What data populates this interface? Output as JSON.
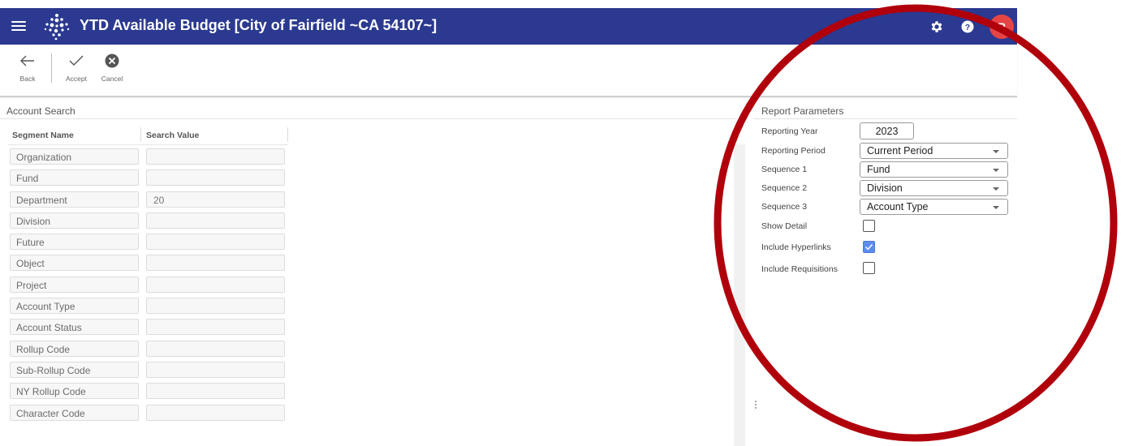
{
  "header": {
    "title": "YTD Available Budget [City of Fairfield ~CA 54107~]",
    "menu_icon": "hamburger-icon",
    "logo_icon": "dotted-diamond-logo",
    "settings_icon": "gear-icon",
    "help_icon": "help-icon",
    "avatar_initial": "P",
    "bar_color": "#2b3990",
    "avatar_color": "#e64545"
  },
  "toolbar": {
    "back_label": "Back",
    "accept_label": "Accept",
    "cancel_label": "Cancel"
  },
  "account_search": {
    "title": "Account Search",
    "col_segment": "Segment Name",
    "col_value": "Search Value",
    "rows": [
      {
        "segment": "Organization",
        "value": ""
      },
      {
        "segment": "Fund",
        "value": ""
      },
      {
        "segment": "Department",
        "value": "20"
      },
      {
        "segment": "Division",
        "value": ""
      },
      {
        "segment": "Future",
        "value": ""
      },
      {
        "segment": "Object",
        "value": ""
      },
      {
        "segment": "Project",
        "value": ""
      },
      {
        "segment": "Account Type",
        "value": ""
      },
      {
        "segment": "Account Status",
        "value": ""
      },
      {
        "segment": "Rollup Code",
        "value": ""
      },
      {
        "segment": "Sub-Rollup Code",
        "value": ""
      },
      {
        "segment": "NY Rollup Code",
        "value": ""
      },
      {
        "segment": "Character Code",
        "value": ""
      }
    ]
  },
  "report_parameters": {
    "title": "Report Parameters",
    "reporting_year_label": "Reporting Year",
    "reporting_year": "2023",
    "reporting_period_label": "Reporting Period",
    "reporting_period": "Current Period",
    "sequence1_label": "Sequence 1",
    "sequence1": "Fund",
    "sequence2_label": "Sequence 2",
    "sequence2": "Division",
    "sequence3_label": "Sequence 3",
    "sequence3": "Account Type",
    "show_detail_label": "Show Detail",
    "show_detail": false,
    "include_hyperlinks_label": "Include Hyperlinks",
    "include_hyperlinks": true,
    "include_requisitions_label": "Include Requisitions",
    "include_requisitions": false,
    "checked_color": "#5b8cf0"
  },
  "annotation": {
    "shape": "ellipse",
    "color": "#b0000c"
  }
}
